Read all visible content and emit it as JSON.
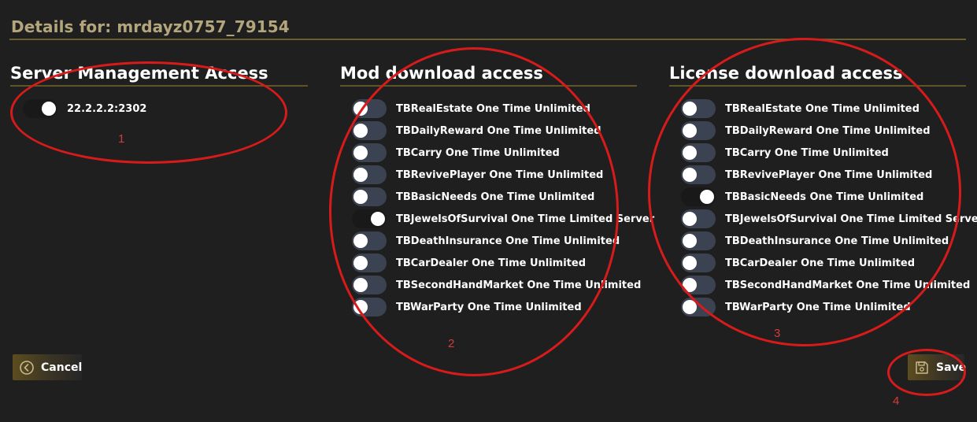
{
  "page_title": "Details for: mrdayz0757_79154",
  "server_section": {
    "title": "Server Management Access",
    "items": [
      {
        "label": "22.2.2.2:2302",
        "on": true
      }
    ]
  },
  "mod_section": {
    "title": "Mod download access",
    "items": [
      {
        "label": "TBRealEstate One Time Unlimited",
        "on": false
      },
      {
        "label": "TBDailyReward One Time Unlimited",
        "on": false
      },
      {
        "label": "TBCarry One Time Unlimited",
        "on": false
      },
      {
        "label": "TBRevivePlayer One Time Unlimited",
        "on": false
      },
      {
        "label": "TBBasicNeeds One Time Unlimited",
        "on": false
      },
      {
        "label": "TBJewelsOfSurvival One Time Limited Server",
        "on": true
      },
      {
        "label": "TBDeathInsurance One Time Unlimited",
        "on": false
      },
      {
        "label": "TBCarDealer One Time Unlimited",
        "on": false
      },
      {
        "label": "TBSecondHandMarket One Time Unlimited",
        "on": false
      },
      {
        "label": "TBWarParty One Time Unlimited",
        "on": false
      }
    ]
  },
  "license_section": {
    "title": "License download access",
    "items": [
      {
        "label": "TBRealEstate One Time Unlimited",
        "on": false
      },
      {
        "label": "TBDailyReward One Time Unlimited",
        "on": false
      },
      {
        "label": "TBCarry One Time Unlimited",
        "on": false
      },
      {
        "label": "TBRevivePlayer One Time Unlimited",
        "on": false
      },
      {
        "label": "TBBasicNeeds One Time Unlimited",
        "on": true
      },
      {
        "label": "TBJewelsOfSurvival One Time Limited Server",
        "on": false
      },
      {
        "label": "TBDeathInsurance One Time Unlimited",
        "on": false
      },
      {
        "label": "TBCarDealer One Time Unlimited",
        "on": false
      },
      {
        "label": "TBSecondHandMarket One Time Unlimited",
        "on": false
      },
      {
        "label": "TBWarParty One Time Unlimited",
        "on": false
      }
    ]
  },
  "buttons": {
    "cancel_label": "Cancel",
    "cancel_icon": "circle-chevron-left-icon",
    "save_label": "Save",
    "save_icon": "floppy-disk-icon"
  },
  "annotations": [
    "1",
    "2",
    "3",
    "4"
  ],
  "colors": {
    "background": "#1f1f1f",
    "title": "#b3a67c",
    "rule": "#6b5e2f",
    "toggle_off": "#3b4252",
    "toggle_on": "#191919",
    "annotation": "#d71b1b"
  }
}
